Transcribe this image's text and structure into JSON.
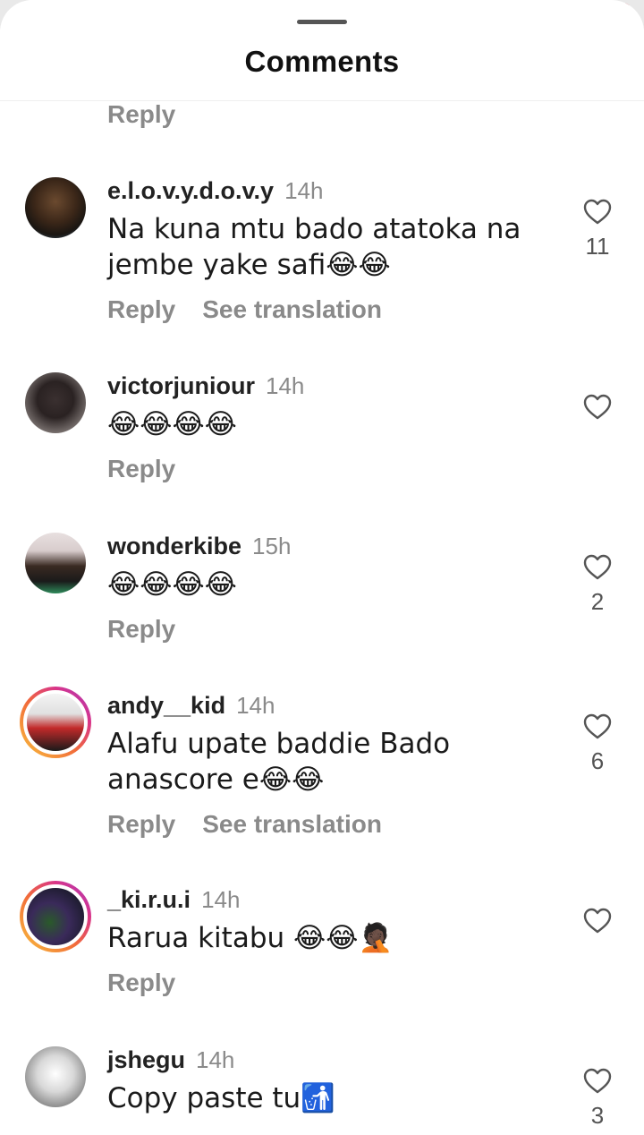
{
  "header": {
    "title": "Comments"
  },
  "orphan_reply": "Reply",
  "comments": [
    {
      "username": "e.l.o.v.y.d.o.v.y",
      "time": "14h",
      "text": "Na kuna mtu bado atatoka na jembe yake safi😂😂",
      "reply": "Reply",
      "translate": "See translation",
      "likes": "11",
      "has_story": false
    },
    {
      "username": "victorjuniour",
      "time": "14h",
      "text": "😂😂😂😂",
      "reply": "Reply",
      "translate": "",
      "likes": "",
      "has_story": false
    },
    {
      "username": "wonderkibe",
      "time": "15h",
      "text": "😂😂😂😂",
      "reply": "Reply",
      "translate": "",
      "likes": "2",
      "has_story": false
    },
    {
      "username": "andy__kid",
      "time": "14h",
      "text": "Alafu upate baddie Bado anascore e😂😂",
      "reply": "Reply",
      "translate": "See translation",
      "likes": "6",
      "has_story": true
    },
    {
      "username": "_ki.r.u.i",
      "time": "14h",
      "text": "Rarua kitabu 😂😂🤦🏿",
      "reply": "Reply",
      "translate": "",
      "likes": "",
      "has_story": true
    },
    {
      "username": "jshegu",
      "time": "14h",
      "text": "Copy paste tu🚮",
      "reply": "",
      "translate": "",
      "likes": "3",
      "has_story": false
    }
  ],
  "icons": {
    "like": "heart-outline-icon"
  },
  "colors": {
    "text": "#1a1a1a",
    "muted": "#8a8a8a",
    "story_ring_start": "#f9c23c",
    "story_ring_end": "#a33ac0"
  }
}
